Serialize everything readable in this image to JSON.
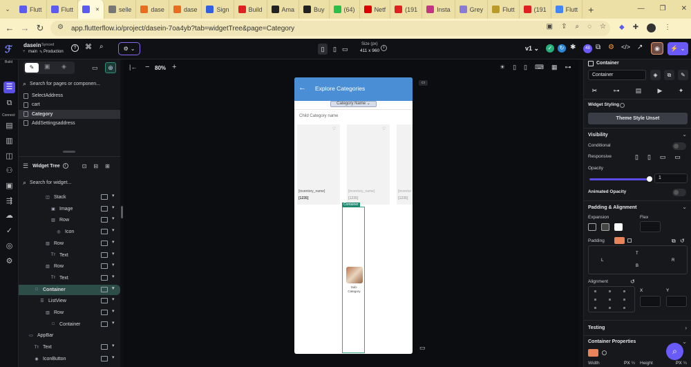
{
  "browser": {
    "tabs": [
      {
        "label": "Flutt",
        "color": "#5b5bf0"
      },
      {
        "label": "Flutt",
        "color": "#5b5bf0"
      },
      {
        "label": "",
        "color": "#5b5bf0",
        "active": true
      },
      {
        "label": "selle",
        "color": "#777"
      },
      {
        "label": "dase",
        "color": "#e86d1f"
      },
      {
        "label": "dase",
        "color": "#e86d1f"
      },
      {
        "label": "Sign",
        "color": "#3060e0"
      },
      {
        "label": "Build",
        "color": "#e02020"
      },
      {
        "label": "Ama",
        "color": "#222"
      },
      {
        "label": "Buy",
        "color": "#222"
      },
      {
        "label": "(64)",
        "color": "#2bbf4a"
      },
      {
        "label": "Netf",
        "color": "#d00"
      },
      {
        "label": "(191",
        "color": "#e02020"
      },
      {
        "label": "Insta",
        "color": "#c13584"
      },
      {
        "label": "Grey",
        "color": "#8a7ad8"
      },
      {
        "label": "Flutt",
        "color": "#b89b2a"
      },
      {
        "label": "(191",
        "color": "#e02020"
      },
      {
        "label": "Flutt",
        "color": "#4285f4"
      }
    ],
    "new_tab": "+",
    "url": "app.flutterflow.io/project/dasein-7oa4yb?tab=widgetTree&page=Category"
  },
  "header": {
    "project_name": "dasein",
    "synced": "Synced",
    "branch": "main",
    "env": "Production",
    "size_label": "Size (px)",
    "size_value": "411 x 960",
    "version": "v1",
    "badge_count": "48"
  },
  "left": {
    "search_pages_placeholder": "Search for pages or componen...",
    "pages": [
      "SelectAddress",
      "cart",
      "Category",
      "AddSettingsaddress"
    ],
    "widget_tree_title": "Widget Tree",
    "search_widget_placeholder": "Search for widget...",
    "tree": [
      {
        "label": "Stack",
        "indent": 3
      },
      {
        "label": "Image",
        "indent": 4
      },
      {
        "label": "Row",
        "indent": 4
      },
      {
        "label": "Icon",
        "indent": 5
      },
      {
        "label": "Row",
        "indent": 3
      },
      {
        "label": "Text",
        "indent": 4
      },
      {
        "label": "Row",
        "indent": 3
      },
      {
        "label": "Text",
        "indent": 4
      },
      {
        "label": "Container",
        "indent": 1,
        "selected": true
      },
      {
        "label": "ListView",
        "indent": 2
      },
      {
        "label": "Row",
        "indent": 3
      },
      {
        "label": "Container",
        "indent": 4
      },
      {
        "label": "AppBar",
        "indent": 0
      },
      {
        "label": "Text",
        "indent": 1
      },
      {
        "label": "IconButton",
        "indent": 1
      }
    ]
  },
  "canvas": {
    "zoom": "80%",
    "appbar_title": "Explore Categories",
    "dropdown_label": "Category Name",
    "child_category_label": "Child Category name",
    "cards": [
      {
        "name": "[inventory_name]",
        "price": "[1235]"
      },
      {
        "name": "[inventory_name]",
        "price": "[1235]"
      },
      {
        "name": "[inventor",
        "price": "[1235]"
      }
    ],
    "container_tag": "Container",
    "sub_category_label": "Sub-\nCategory"
  },
  "right": {
    "widget_type": "Container",
    "widget_name": "Container",
    "widget_styling": "Widget Styling",
    "theme_style_button": "Theme Style Unset",
    "visibility": "Visibility",
    "conditional": "Conditional",
    "responsive": "Responsive",
    "opacity_label": "Opacity",
    "opacity_value": "1",
    "animated_opacity": "Animated Opacity",
    "padding_alignment": "Padding & Alignment",
    "expansion": "Expansion",
    "flex": "Flex",
    "padding": "Padding",
    "pad_t": "T",
    "pad_l": "L",
    "pad_r": "R",
    "pad_b": "B",
    "alignment": "Alignment",
    "align_x": "X",
    "align_y": "Y",
    "testing": "Testing",
    "container_properties": "Container Properties",
    "width": "Width",
    "height": "Height",
    "px": "PX",
    "pct": "%"
  },
  "colors": {
    "accent": "#6a5af9",
    "appbar": "#4a8fd6",
    "selected_tree": "#2d4e48",
    "container_tag": "#1f8a70"
  }
}
